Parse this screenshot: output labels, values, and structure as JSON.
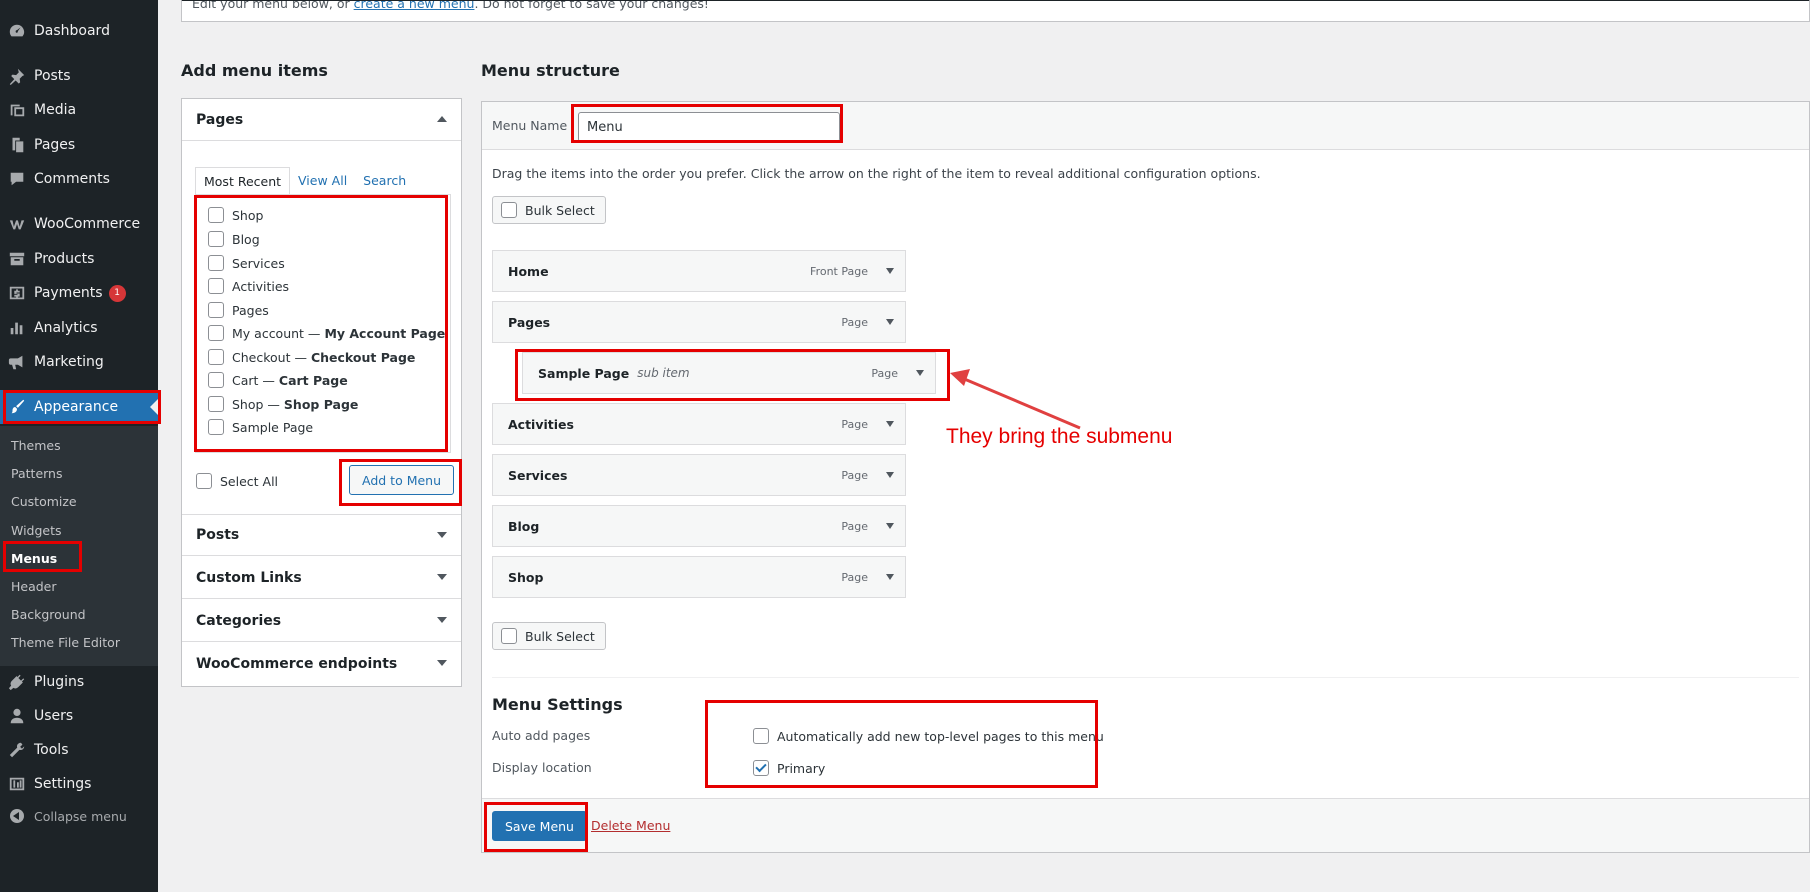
{
  "sidebar": {
    "items": [
      {
        "label": "Dashboard",
        "icon": "dashboard-icon"
      },
      {
        "label": "Posts",
        "icon": "pin-icon"
      },
      {
        "label": "Media",
        "icon": "media-icon"
      },
      {
        "label": "Pages",
        "icon": "pages-icon"
      },
      {
        "label": "Comments",
        "icon": "comment-icon"
      },
      {
        "label": "WooCommerce",
        "icon": "woocommerce-icon"
      },
      {
        "label": "Products",
        "icon": "archive-icon"
      },
      {
        "label": "Payments",
        "icon": "payments-icon",
        "badge": "1"
      },
      {
        "label": "Analytics",
        "icon": "chart-icon"
      },
      {
        "label": "Marketing",
        "icon": "megaphone-icon"
      },
      {
        "label": "Appearance",
        "icon": "brush-icon",
        "current": true
      },
      {
        "label": "Plugins",
        "icon": "plug-icon"
      },
      {
        "label": "Users",
        "icon": "user-icon"
      },
      {
        "label": "Tools",
        "icon": "wrench-icon"
      },
      {
        "label": "Settings",
        "icon": "sliders-icon"
      }
    ],
    "submenu": [
      "Themes",
      "Patterns",
      "Customize",
      "Widgets",
      "Menus",
      "Header",
      "Background",
      "Theme File Editor"
    ],
    "collapse_label": "Collapse menu"
  },
  "notice": {
    "text_before": "Edit your menu below, or ",
    "link": "create a new menu",
    "text_after": ". Do not forget to save your changes!"
  },
  "add_items": {
    "title": "Add menu items",
    "pages_panel": {
      "title": "Pages",
      "tabs": [
        "Most Recent",
        "View All",
        "Search"
      ],
      "pages": [
        {
          "label": "Shop",
          "suffix": ""
        },
        {
          "label": "Blog",
          "suffix": ""
        },
        {
          "label": "Services",
          "suffix": ""
        },
        {
          "label": "Activities",
          "suffix": ""
        },
        {
          "label": "Pages",
          "suffix": ""
        },
        {
          "label": "My account —",
          "suffix": "My Account Page"
        },
        {
          "label": "Checkout —",
          "suffix": "Checkout Page"
        },
        {
          "label": "Cart —",
          "suffix": "Cart Page"
        },
        {
          "label": "Shop —",
          "suffix": "Shop Page"
        },
        {
          "label": "Sample Page",
          "suffix": ""
        }
      ],
      "select_all": "Select All",
      "add_button": "Add to Menu"
    },
    "other_panels": [
      "Posts",
      "Custom Links",
      "Categories",
      "WooCommerce endpoints"
    ]
  },
  "menu_structure": {
    "title": "Menu structure",
    "name_label": "Menu Name",
    "name_value": "Menu",
    "instructions": "Drag the items into the order you prefer. Click the arrow on the right of the item to reveal additional configuration options.",
    "bulk_select": "Bulk Select",
    "items": [
      {
        "title": "Home",
        "type": "Front Page",
        "sub_label": ""
      },
      {
        "title": "Pages",
        "type": "Page",
        "sub_label": ""
      },
      {
        "title": "Sample Page",
        "type": "Page",
        "sub_label": "sub item"
      },
      {
        "title": "Activities",
        "type": "Page",
        "sub_label": ""
      },
      {
        "title": "Services",
        "type": "Page",
        "sub_label": ""
      },
      {
        "title": "Blog",
        "type": "Page",
        "sub_label": ""
      },
      {
        "title": "Shop",
        "type": "Page",
        "sub_label": ""
      }
    ],
    "settings": {
      "title": "Menu Settings",
      "auto_add_label": "Auto add pages",
      "auto_add_option": "Automatically add new top-level pages to this menu",
      "auto_add_checked": false,
      "display_location_label": "Display location",
      "location_option": "Primary",
      "location_checked": true
    },
    "save_button": "Save Menu",
    "delete_link": "Delete Menu"
  },
  "annotation": {
    "text": "They bring the submenu",
    "color": "#e50000"
  },
  "colors": {
    "sidebar_bg": "#1d2327",
    "accent": "#2271b1",
    "danger": "#b32d2e"
  }
}
